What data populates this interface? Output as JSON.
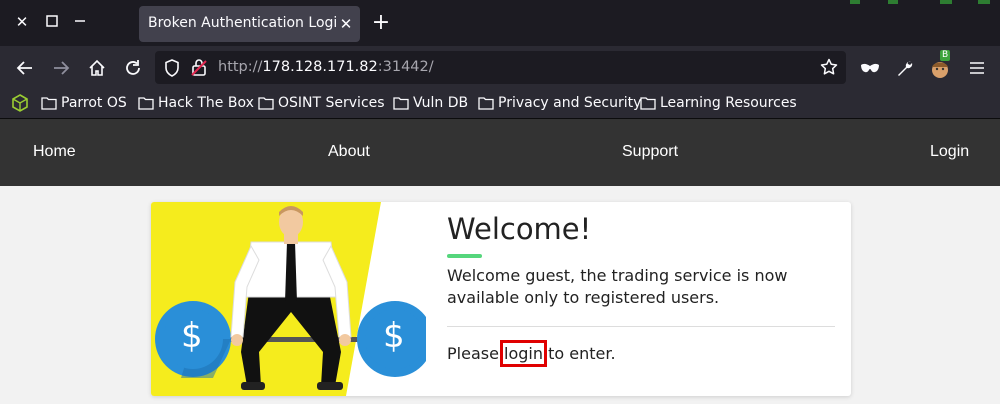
{
  "browser": {
    "tab_title": "Broken Authentication Login",
    "url": {
      "scheme": "http://",
      "host": "178.128.171.82",
      "port": ":31442/"
    },
    "bookmarks": [
      {
        "label": "Parrot OS"
      },
      {
        "label": "Hack The Box"
      },
      {
        "label": "OSINT Services"
      },
      {
        "label": "Vuln DB"
      },
      {
        "label": "Privacy and Security"
      },
      {
        "label": "Learning Resources"
      }
    ],
    "extension_badge": "B"
  },
  "site": {
    "nav": {
      "home": "Home",
      "about": "About",
      "support": "Support",
      "login": "Login"
    },
    "card": {
      "title": "Welcome!",
      "intro": "Welcome guest, the trading service is now available only to registered users.",
      "please_prefix": "Please ",
      "login_link": "login",
      "please_suffix": " to enter.",
      "coin_symbol": "$"
    }
  },
  "colors": {
    "accent": "#55d67c",
    "highlight": "#e00000",
    "image_bg": "#f5ec1d",
    "coin": "#2a8fd8"
  }
}
